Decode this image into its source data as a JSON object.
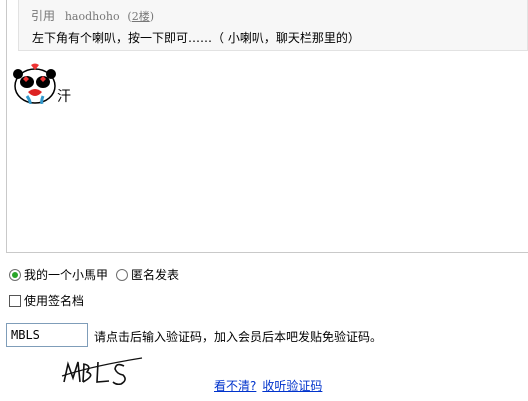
{
  "quote": {
    "prefix": "引用",
    "user": "haodhoho",
    "floor": "2楼",
    "text": "左下角有个喇叭，按一下即可……（ 小喇叭，聊天栏那里的）"
  },
  "editor": {
    "text_after_emoticon": "汗",
    "emoticon": "panda-sweat-emoticon"
  },
  "identity": {
    "option1": "我的一个小馬甲",
    "option2": "匿名发表",
    "selected": "我的一个小馬甲"
  },
  "signature": {
    "label": "使用签名档",
    "checked": false
  },
  "verification": {
    "value": "MBLS",
    "hint": "请点击后输入验证码，加入会员后本吧发贴免验证码。",
    "captcha_text": "MBLS",
    "unclear_link": "看不清?",
    "listen_link": "收听验证码"
  },
  "colors": {
    "radio_selected": "#2aa52a",
    "link": "#0033cc"
  }
}
